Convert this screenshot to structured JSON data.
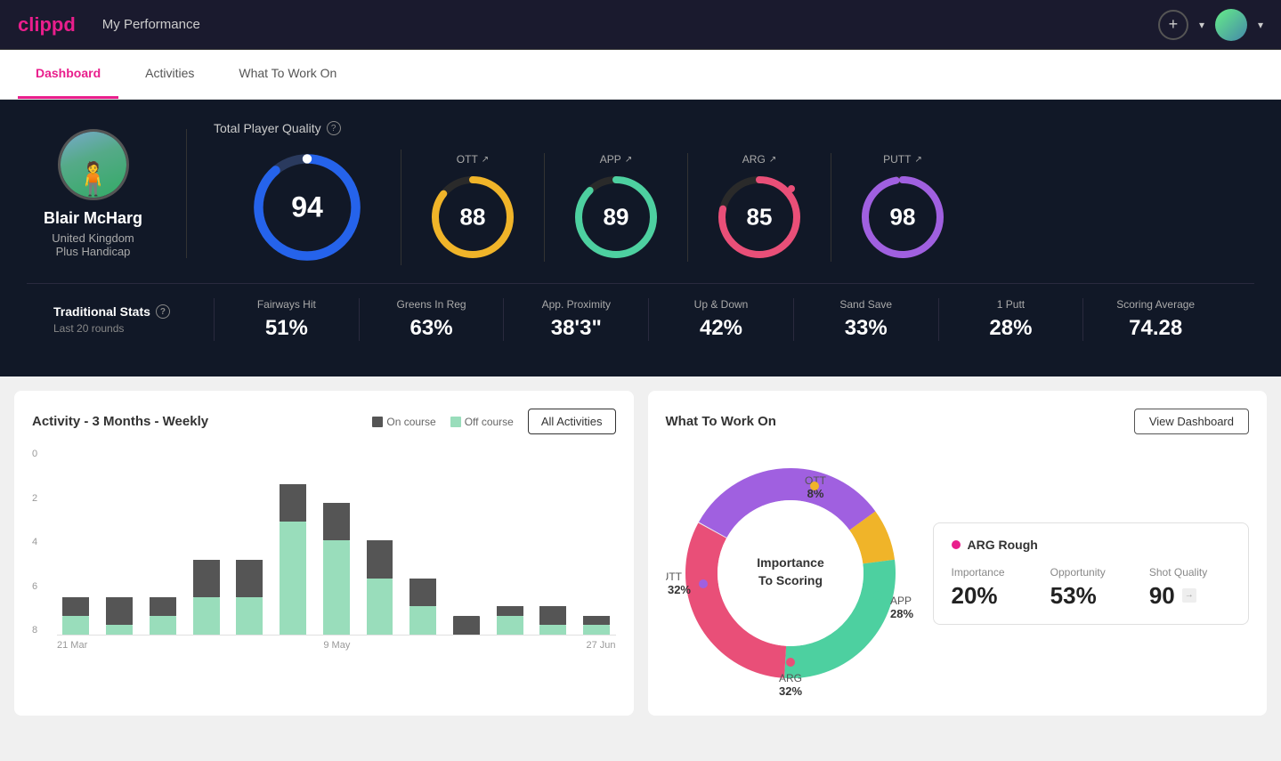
{
  "header": {
    "logo": "clippd",
    "title": "My Performance",
    "add_icon": "+",
    "dropdown_icon": "▾"
  },
  "tabs": [
    {
      "id": "dashboard",
      "label": "Dashboard",
      "active": true
    },
    {
      "id": "activities",
      "label": "Activities",
      "active": false
    },
    {
      "id": "what-to-work-on",
      "label": "What To Work On",
      "active": false
    }
  ],
  "player": {
    "name": "Blair McHarg",
    "country": "United Kingdom",
    "handicap": "Plus Handicap"
  },
  "total_quality": {
    "label": "Total Player Quality",
    "score": 94
  },
  "gauges": [
    {
      "id": "ott",
      "label": "OTT",
      "value": 88,
      "color": "#f0b429",
      "track": "#2a2a2a"
    },
    {
      "id": "app",
      "label": "APP",
      "value": 89,
      "color": "#4dd0a0",
      "track": "#2a2a2a"
    },
    {
      "id": "arg",
      "label": "ARG",
      "value": 85,
      "color": "#e94f78",
      "track": "#2a2a2a"
    },
    {
      "id": "putt",
      "label": "PUTT",
      "value": 98,
      "color": "#a060e0",
      "track": "#2a2a2a"
    }
  ],
  "traditional_stats": {
    "title": "Traditional Stats",
    "subtitle": "Last 20 rounds",
    "stats": [
      {
        "name": "Fairways Hit",
        "value": "51%"
      },
      {
        "name": "Greens In Reg",
        "value": "63%"
      },
      {
        "name": "App. Proximity",
        "value": "38'3\""
      },
      {
        "name": "Up & Down",
        "value": "42%"
      },
      {
        "name": "Sand Save",
        "value": "33%"
      },
      {
        "name": "1 Putt",
        "value": "28%"
      },
      {
        "name": "Scoring Average",
        "value": "74.28"
      }
    ]
  },
  "activity_chart": {
    "title": "Activity - 3 Months - Weekly",
    "legend": {
      "on_course": "On course",
      "off_course": "Off course"
    },
    "all_activities_btn": "All Activities",
    "y_labels": [
      "0",
      "2",
      "4",
      "6",
      "8"
    ],
    "x_labels": [
      "21 Mar",
      "9 May",
      "27 Jun"
    ],
    "bars": [
      {
        "on": 1,
        "off": 1
      },
      {
        "on": 1.5,
        "off": 0.5
      },
      {
        "on": 1,
        "off": 1
      },
      {
        "on": 2,
        "off": 2
      },
      {
        "on": 2,
        "off": 2
      },
      {
        "on": 2,
        "off": 6
      },
      {
        "on": 2,
        "off": 5
      },
      {
        "on": 2,
        "off": 3
      },
      {
        "on": 1.5,
        "off": 1.5
      },
      {
        "on": 1,
        "off": 0
      },
      {
        "on": 0.5,
        "off": 1
      },
      {
        "on": 1,
        "off": 0.5
      },
      {
        "on": 0.5,
        "off": 0.5
      }
    ],
    "max_value": 9
  },
  "what_to_work_on": {
    "title": "What To Work On",
    "view_dashboard_btn": "View Dashboard",
    "donut_center": "Importance\nTo Scoring",
    "segments": [
      {
        "label": "OTT",
        "pct": "8%",
        "color": "#f0b429",
        "value": 8
      },
      {
        "label": "APP",
        "pct": "28%",
        "color": "#4dd0a0",
        "value": 28
      },
      {
        "label": "ARG",
        "pct": "32%",
        "color": "#e94f78",
        "value": 32
      },
      {
        "label": "PUTT",
        "pct": "32%",
        "color": "#a060e0",
        "value": 32
      }
    ],
    "detail": {
      "title": "ARG Rough",
      "dot_color": "#e94f78",
      "importance_label": "Importance",
      "importance_value": "20%",
      "opportunity_label": "Opportunity",
      "opportunity_value": "53%",
      "shot_quality_label": "Shot Quality",
      "shot_quality_value": "90"
    }
  }
}
